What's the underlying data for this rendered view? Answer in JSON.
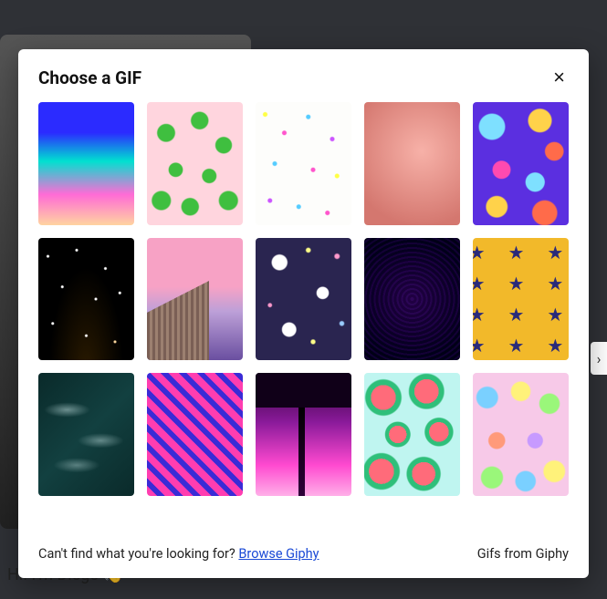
{
  "background": {
    "greeting": "Hi! I'm Diego 👋"
  },
  "modal": {
    "title": "Choose a GIF",
    "close_label": "×",
    "gifs": [
      {
        "name": "rainbow-gradient"
      },
      {
        "name": "pink-leaves-pattern"
      },
      {
        "name": "confetti-pattern"
      },
      {
        "name": "pink-texture"
      },
      {
        "name": "purple-abstract-shapes"
      },
      {
        "name": "night-starfield"
      },
      {
        "name": "pink-sky-building"
      },
      {
        "name": "navy-eyes-stars"
      },
      {
        "name": "dark-purple-texture"
      },
      {
        "name": "yellow-blue-stars"
      },
      {
        "name": "dark-water-ripples"
      },
      {
        "name": "pink-blue-squiggles"
      },
      {
        "name": "purple-sunset-silhouette"
      },
      {
        "name": "watermelon-pattern"
      },
      {
        "name": "pastel-animal-doodles"
      }
    ],
    "footer": {
      "prompt": "Can't find what you're looking for? ",
      "link_label": "Browse Giphy",
      "attribution": "Gifs from Giphy"
    }
  }
}
